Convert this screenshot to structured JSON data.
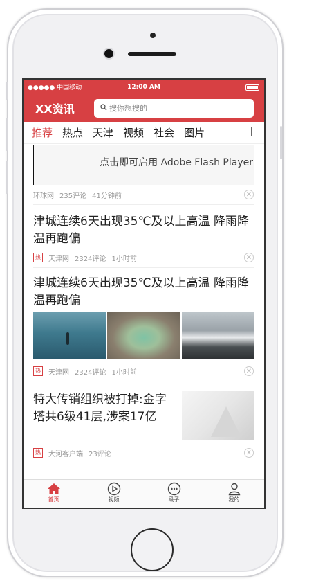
{
  "status": {
    "carrier": "●●●●● 中国移动",
    "time": "12:00 AM"
  },
  "header": {
    "logo": "XX资讯",
    "search_placeholder": "搜你想搜的"
  },
  "tabs": [
    {
      "label": "推荐",
      "active": true
    },
    {
      "label": "热点"
    },
    {
      "label": "天津"
    },
    {
      "label": "视频"
    },
    {
      "label": "社会"
    },
    {
      "label": "图片"
    }
  ],
  "tab_add": "+",
  "articles": [
    {
      "flash": "点击即可启用 Adobe Flash Player",
      "source": "环球网",
      "comments": "235评论",
      "time": "41分钟前"
    },
    {
      "title": "津城连续6天出现35℃及以上高温 降雨降温再跑偏",
      "badge": "热",
      "source": "天津网",
      "comments": "2324评论",
      "time": "1小时前"
    },
    {
      "title": "津城连续6天出现35℃及以上高温 降雨降温再跑偏",
      "badge": "热",
      "source": "天津网",
      "comments": "2324评论",
      "time": "1小时前"
    },
    {
      "title": "特大传销组织被打掉:金字塔共6级41层,涉案17亿",
      "badge": "热",
      "source": "大河客户端",
      "comments": "23评论"
    }
  ],
  "bottom_nav": [
    {
      "label": "首页",
      "icon": "home-icon",
      "active": true
    },
    {
      "label": "视频",
      "icon": "play-icon"
    },
    {
      "label": "段子",
      "icon": "chat-icon"
    },
    {
      "label": "我的",
      "icon": "user-icon"
    }
  ],
  "colors": {
    "accent": "#d74043"
  }
}
